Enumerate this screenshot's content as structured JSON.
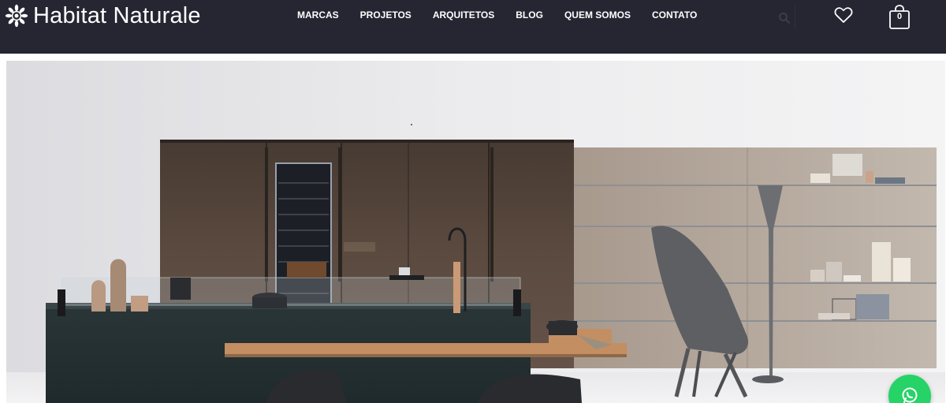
{
  "brand": {
    "name": "Habitat Naturale",
    "logo_icon": "sunflower-icon"
  },
  "nav": {
    "items": [
      {
        "label": "MARCAS"
      },
      {
        "label": "PROJETOS"
      },
      {
        "label": "ARQUITETOS"
      },
      {
        "label": "BLOG"
      },
      {
        "label": "QUEM SOMOS"
      },
      {
        "label": "CONTATO"
      }
    ]
  },
  "header_actions": {
    "search_icon": "search-icon",
    "wishlist_icon": "heart-icon",
    "cart_icon": "shopping-bag-icon",
    "cart_count": "0"
  },
  "hero": {
    "image": "modern-kitchen-photo"
  },
  "chat_widget": {
    "icon": "whatsapp-icon",
    "color": "#25d366"
  },
  "colors": {
    "header_bg": "#262633",
    "nav_text": "#ffffff"
  }
}
